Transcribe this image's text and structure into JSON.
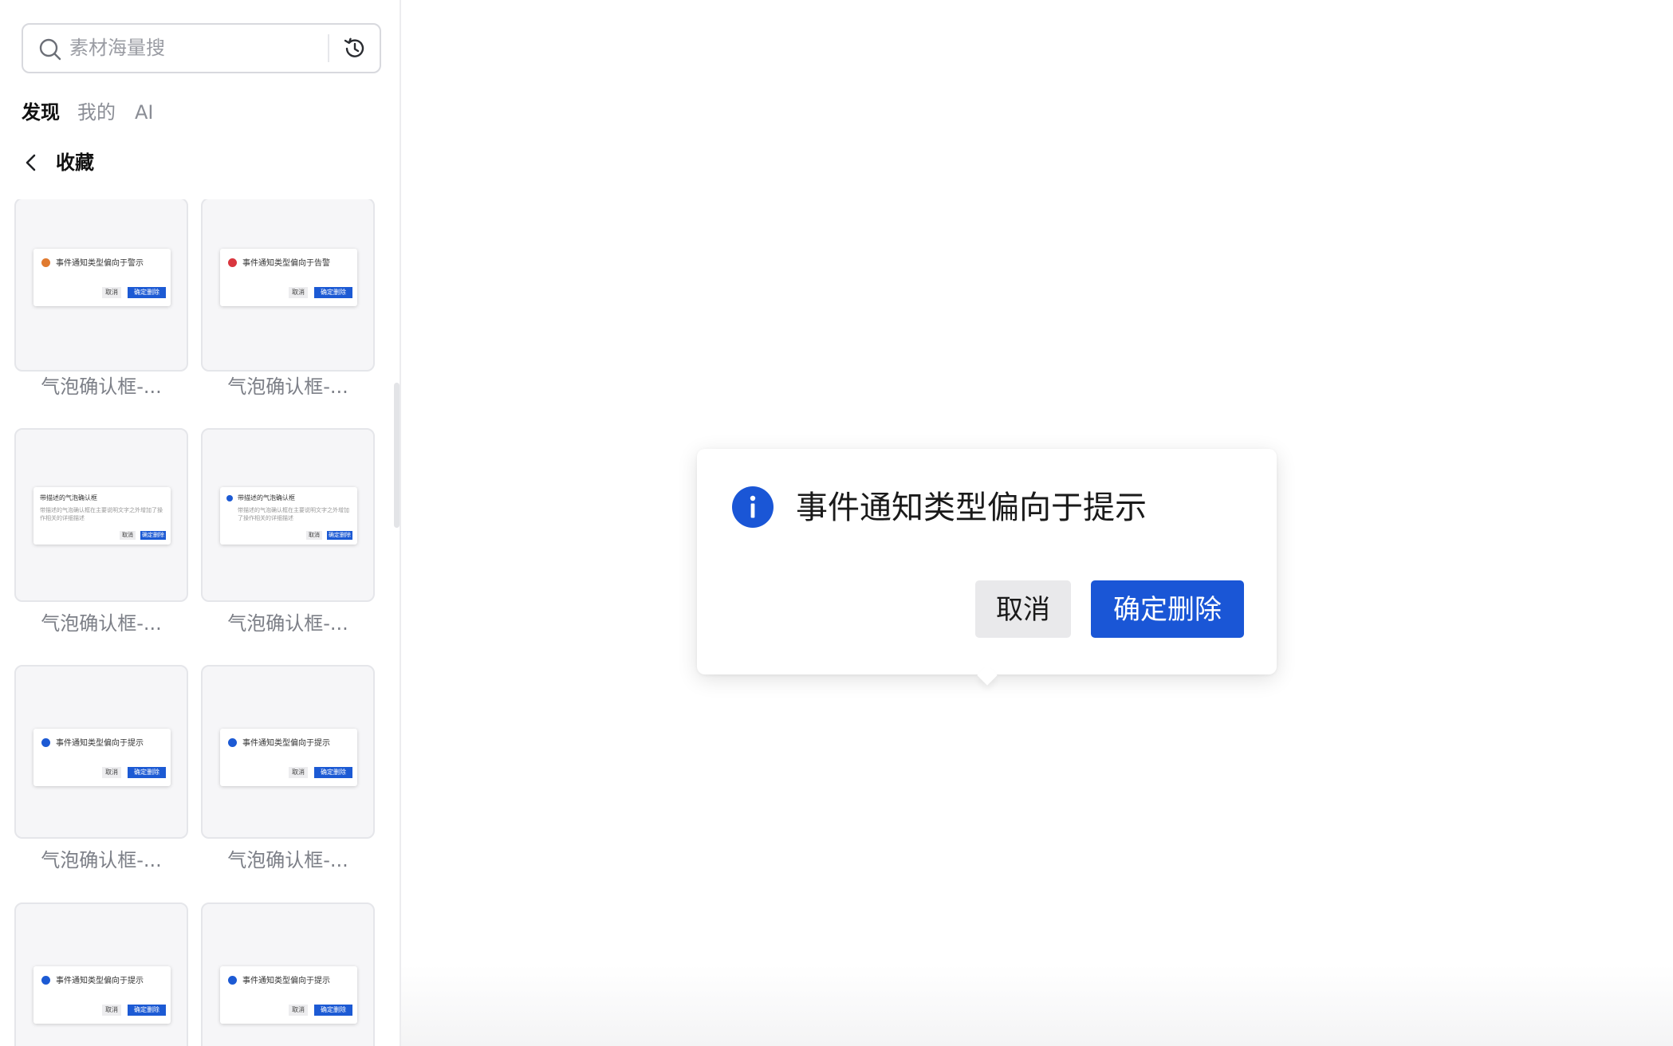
{
  "search": {
    "placeholder": "素材海量搜",
    "icon": "search-icon",
    "history_icon": "history-icon"
  },
  "tabs": [
    {
      "label": "发现",
      "active": true
    },
    {
      "label": "我的",
      "active": false
    },
    {
      "label": "AI",
      "active": false
    }
  ],
  "section": {
    "back_icon": "chevron-left-icon",
    "title": "收藏"
  },
  "cards": [
    {
      "label": "气泡确认框-...",
      "preview": {
        "type": "icon",
        "dot_color": "#e07a2f",
        "title": "事件通知类型偏向于警示",
        "cancel": "取消",
        "ok": "确定删除"
      }
    },
    {
      "label": "气泡确认框-...",
      "preview": {
        "type": "icon",
        "dot_color": "#d9363e",
        "title": "事件通知类型偏向于告警",
        "cancel": "取消",
        "ok": "确定删除"
      }
    },
    {
      "label": "气泡确认框-...",
      "preview": {
        "type": "desc",
        "title": "带描述的气泡确认框",
        "desc": "带描述的气泡确认框在主要说明文字之外增加了操作相关的详细描述",
        "cancel": "取消",
        "ok": "确定删除"
      }
    },
    {
      "label": "气泡确认框-...",
      "preview": {
        "type": "desc-icon",
        "dot_color": "#1c5ad4",
        "title": "带描述的气泡确认框",
        "desc": "带描述的气泡确认框在主要说明文字之外增加了操作相关的详细描述",
        "cancel": "取消",
        "ok": "确定删除"
      }
    },
    {
      "label": "气泡确认框-...",
      "preview": {
        "type": "icon",
        "dot_color": "#1c5ad4",
        "title": "事件通知类型偏向于提示",
        "cancel": "取消",
        "ok": "确定删除"
      }
    },
    {
      "label": "气泡确认框-...",
      "preview": {
        "type": "icon",
        "dot_color": "#1c5ad4",
        "title": "事件通知类型偏向于提示",
        "cancel": "取消",
        "ok": "确定删除"
      }
    },
    {
      "label": "",
      "preview": {
        "type": "icon",
        "dot_color": "#1c5ad4",
        "title": "事件通知类型偏向于提示",
        "cancel": "取消",
        "ok": "确定删除"
      }
    },
    {
      "label": "",
      "preview": {
        "type": "icon",
        "dot_color": "#1c5ad4",
        "title": "事件通知类型偏向于提示",
        "cancel": "取消",
        "ok": "确定删除"
      }
    }
  ],
  "popover": {
    "icon": "info-icon",
    "title": "事件通知类型偏向于提示",
    "cancel_label": "取消",
    "confirm_label": "确定删除"
  },
  "colors": {
    "primary": "#1a56d6",
    "info_icon": "#1a56d6",
    "cancel_bg": "#e9e9eb"
  }
}
